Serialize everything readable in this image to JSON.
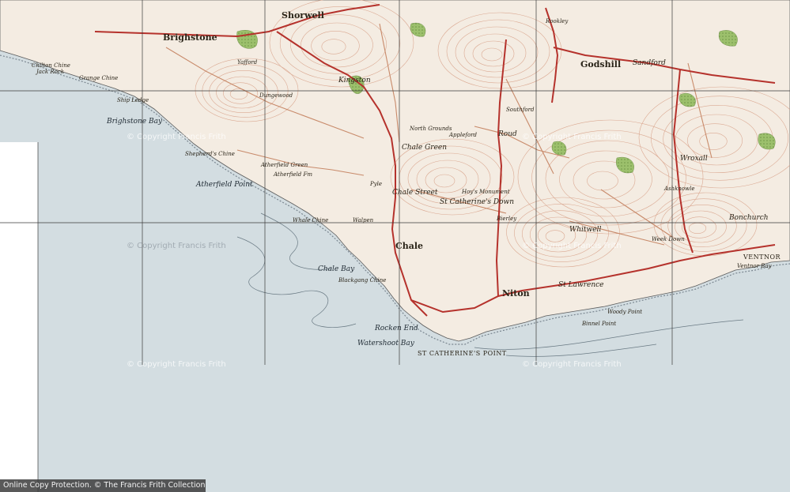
{
  "map": {
    "colors": {
      "sea": "#d3dde1",
      "land": "#f4ece2",
      "road_main": "#b5322c",
      "road_minor": "#c88a6a",
      "contour": "#d8a28a",
      "woodland": "#8fb462",
      "grid": "#3a3a3a",
      "margin": "#ffffff"
    },
    "places": {
      "shorwell": "Shorwell",
      "brighstone": "Brighstone",
      "kingston": "Kingston",
      "godshill": "Godshill",
      "sandford": "Sandford",
      "chale_green": "Chale Green",
      "chale_street": "Chale Street",
      "chale": "Chale",
      "niton": "Niton",
      "whitwell": "Whitwell",
      "wroxall": "Wroxall",
      "bonchurch": "Bonchurch",
      "ventnor": "VENTNOR",
      "st_lawrence": "St Lawrence",
      "st_catherines_down": "St Catherine's Down",
      "atherfield_green": "Atherfield Green",
      "atherfield_point": "Atherfield Point",
      "brighstone_bay": "Brighstone Bay",
      "chale_bay": "Chale Bay",
      "blackgang_chine": "Blackgang Chine",
      "rocken_end": "Rocken End",
      "watershoot_bay": "Watershoot Bay",
      "st_catherines_point": "ST CATHERINE'S POINT",
      "whale_chine": "Whale Chine",
      "ship_ledge": "Ship Ledge",
      "grange_chine": "Grange Chine",
      "woody_point": "Woody Point",
      "binnel_point": "Binnel Point",
      "ventnor_bay": "Ventnor Bay",
      "yafford": "Yafford",
      "dungewood": "Dungewood",
      "pyle": "Pyle",
      "walpen": "Walpen",
      "roud": "Roud",
      "rookley": "Rookley",
      "appleford": "Appleford",
      "north_grounds": "North Grounds",
      "southford": "Southford",
      "week_down": "Week Down",
      "bierley": "Bierley",
      "hoy_monument": "Hoy's Monument",
      "atherfield_farm": "Atherfield Fm",
      "shepherds_chine": "Shepherd's Chine",
      "chilton_chine": "Chilton Chine",
      "jackrock": "Jack Rock",
      "ashknowle": "Ashknowle"
    },
    "watermark": "© Copyright Francis Frith",
    "footer": "Online Copy Protection. © The Francis Frith Collection"
  }
}
